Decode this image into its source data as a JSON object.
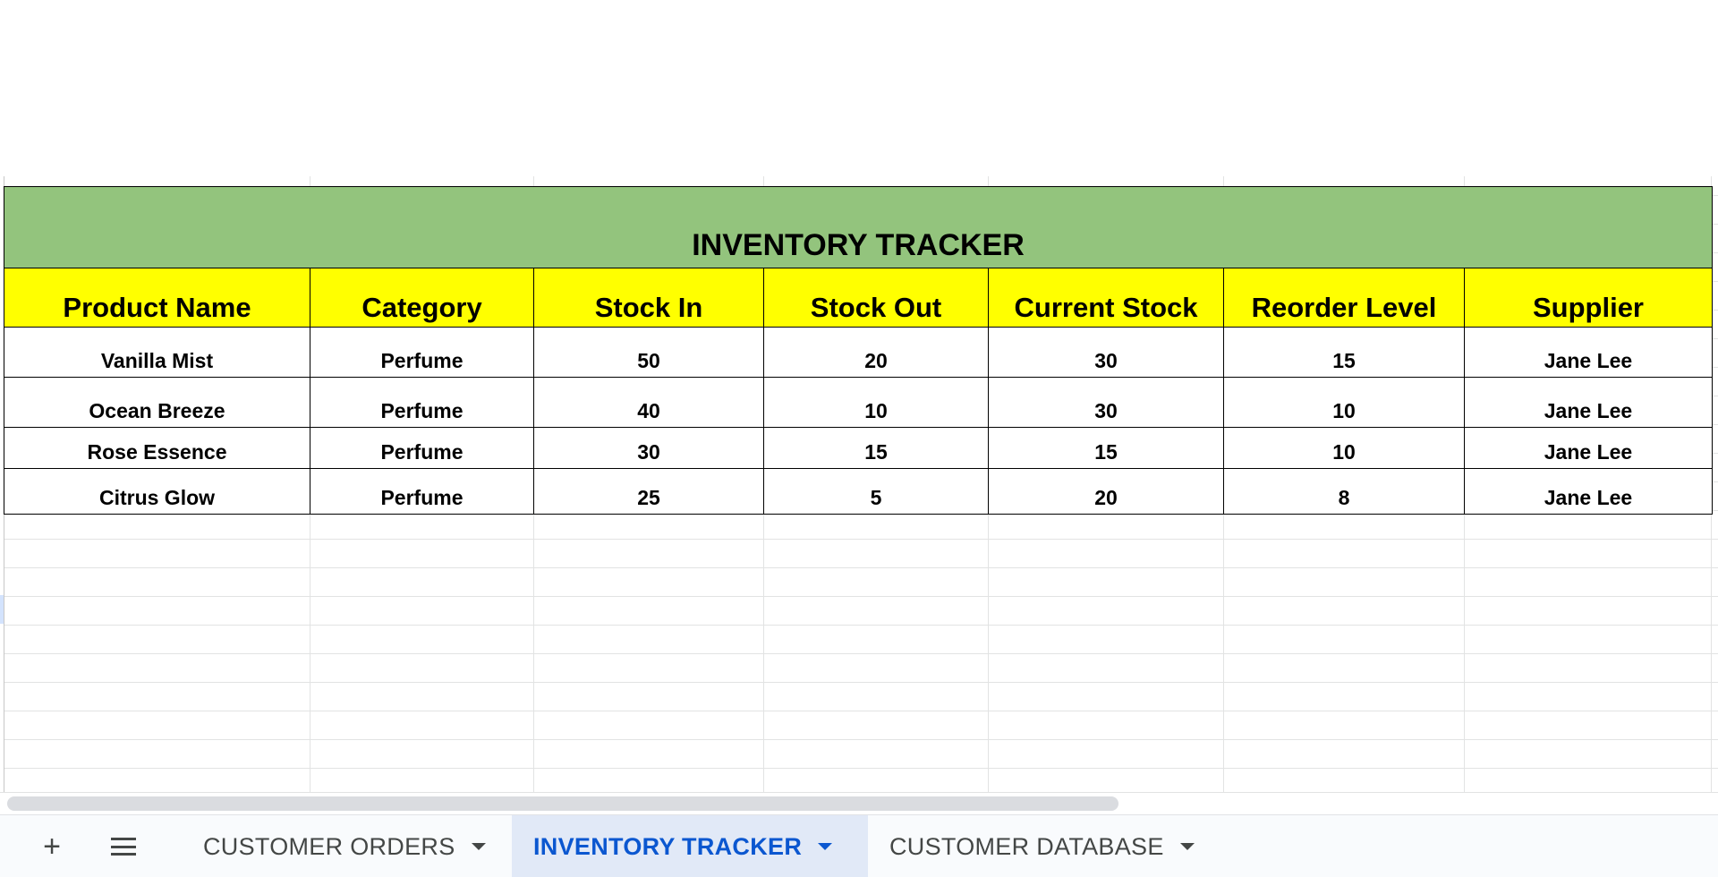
{
  "sheet": {
    "title": "INVENTORY TRACKER",
    "columns": [
      "Product Name",
      "Category",
      "Stock In",
      "Stock Out",
      "Current Stock",
      "Reorder Level",
      "Supplier"
    ],
    "rows": [
      [
        "Vanilla Mist",
        "Perfume",
        "50",
        "20",
        "30",
        "15",
        "Jane Lee"
      ],
      [
        "Ocean Breeze",
        "Perfume",
        "40",
        "10",
        "30",
        "10",
        "Jane Lee"
      ],
      [
        "Rose Essence",
        "Perfume",
        "30",
        "15",
        "15",
        "10",
        "Jane Lee"
      ],
      [
        "Citrus Glow",
        "Perfume",
        "25",
        "5",
        "20",
        "8",
        "Jane Lee"
      ]
    ]
  },
  "tabbar": {
    "add_icon": "+",
    "tabs": [
      {
        "label": "CUSTOMER ORDERS",
        "active": false
      },
      {
        "label": "INVENTORY TRACKER",
        "active": true
      },
      {
        "label": "CUSTOMER DATABASE",
        "active": false
      }
    ]
  },
  "colors": {
    "title_bg": "#93c47d",
    "header_bg": "#ffff00",
    "active_tab_text": "#0b57d0",
    "active_tab_bg": "#e1e9f7"
  }
}
